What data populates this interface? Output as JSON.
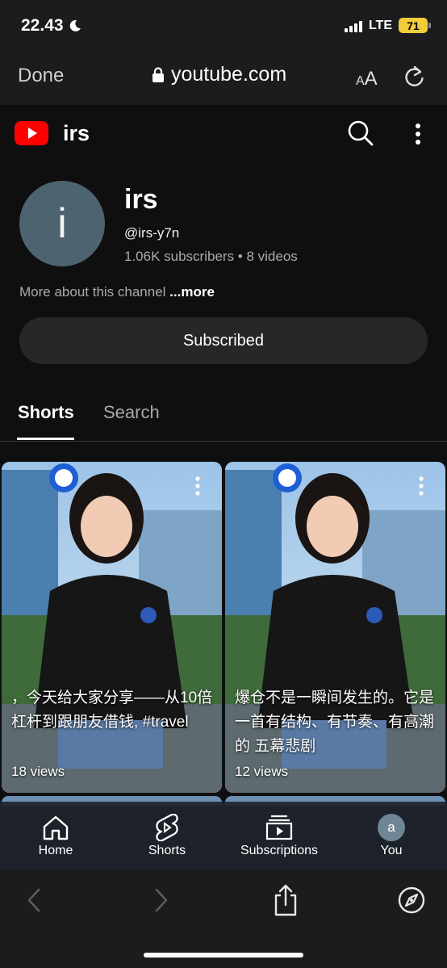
{
  "status_bar": {
    "time": "22.43",
    "network": "LTE",
    "battery": "71"
  },
  "browser": {
    "done_label": "Done",
    "url": "youtube.com",
    "text_size_label_small": "A",
    "text_size_label_big": "A"
  },
  "youtube_header": {
    "title": "irs"
  },
  "channel": {
    "avatar_letter": "i",
    "name": "irs",
    "handle": "@irs-y7n",
    "stats": "1.06K subscribers • 8 videos",
    "more_text": "More about this channel ",
    "more_link": "...more",
    "subscribe_label": "Subscribed"
  },
  "tabs": [
    {
      "label": "Shorts",
      "selected": true
    },
    {
      "label": "Search",
      "selected": false
    }
  ],
  "shorts": [
    {
      "caption": "，今天给大家分享——从10倍杠杆到跟朋友借钱, #travel",
      "views": "18 views"
    },
    {
      "caption": "爆仓不是一瞬间发生的。它是一首有结构、有节奏、有高潮的 五幕悲剧",
      "views": "12 views"
    }
  ],
  "bottom_nav": [
    {
      "label": "Home",
      "icon": "home-icon"
    },
    {
      "label": "Shorts",
      "icon": "shorts-icon"
    },
    {
      "label": "Subscriptions",
      "icon": "subscriptions-icon"
    },
    {
      "label": "You",
      "icon": "avatar",
      "avatar_letter": "a"
    }
  ],
  "browser_toolbar": [
    "back-icon",
    "forward-icon",
    "share-icon",
    "compass-icon"
  ],
  "colors": {
    "background": "#0f0f0f",
    "youtube_red": "#ff0000",
    "battery": "#f2cd3a",
    "secondary_text": "#aaaaaa"
  }
}
